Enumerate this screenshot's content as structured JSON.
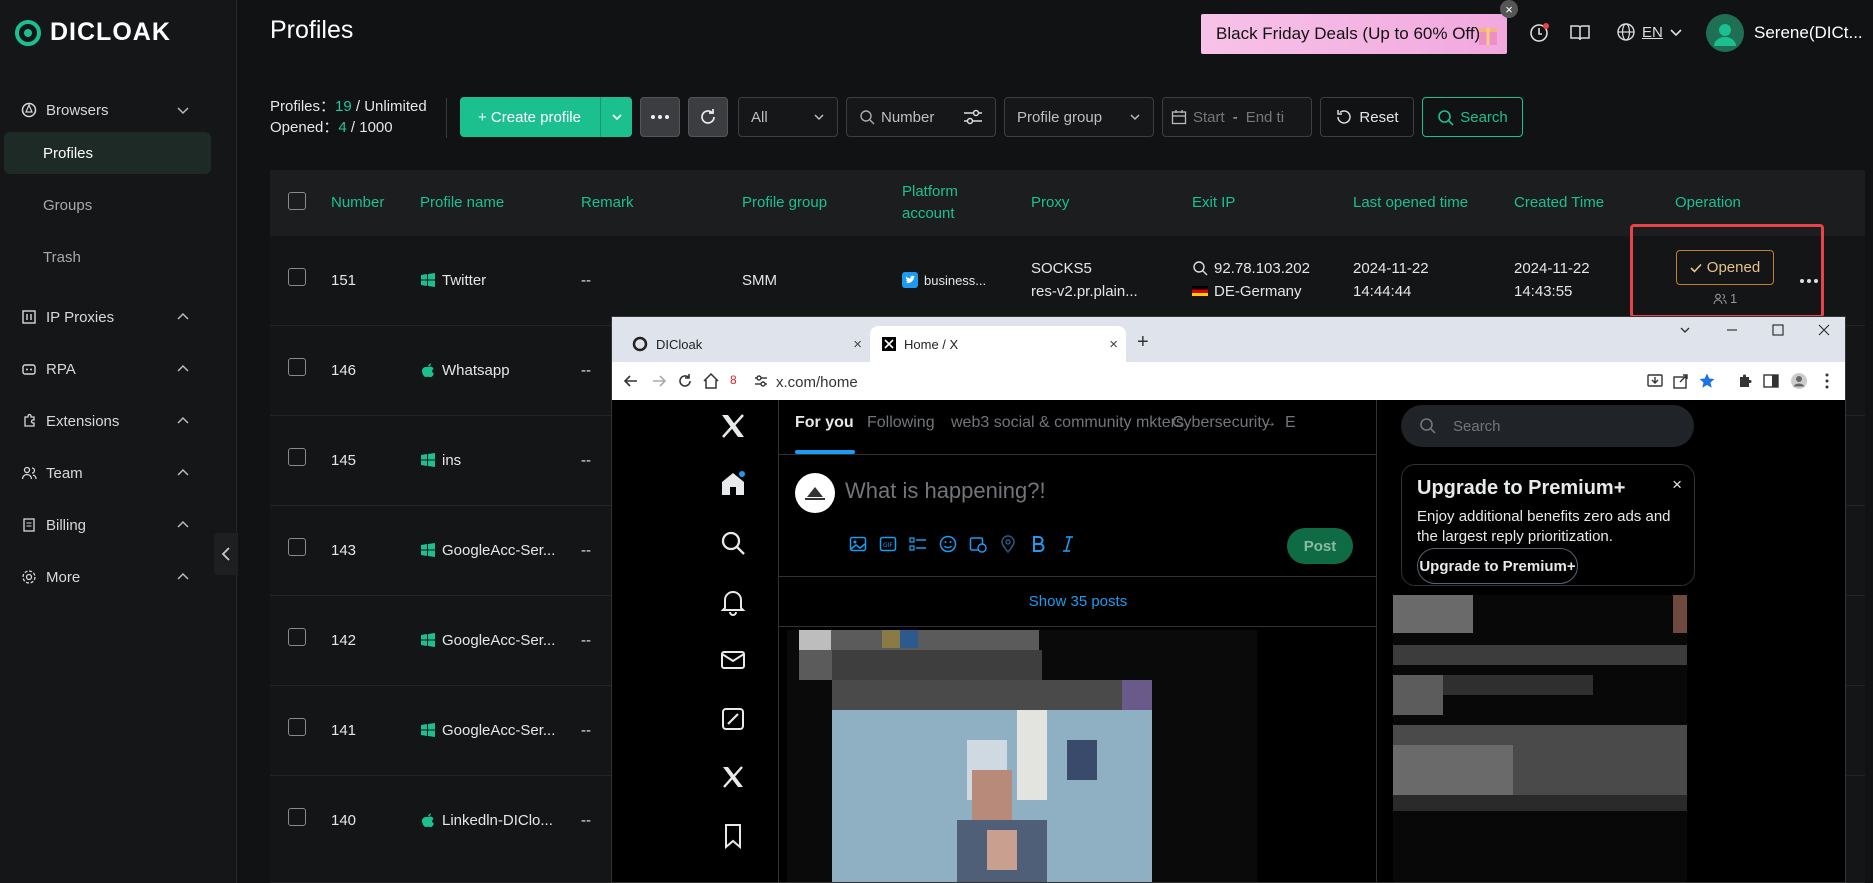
{
  "sidebar": {
    "logo": "DICLOAK",
    "browsers": "Browsers",
    "profiles": "Profiles",
    "groups": "Groups",
    "trash": "Trash",
    "ip_proxies": "IP Proxies",
    "rpa": "RPA",
    "extensions": "Extensions",
    "team": "Team",
    "billing": "Billing",
    "more": "More"
  },
  "header": {
    "title": "Profiles",
    "promo": "Black Friday Deals (Up to 60% Off)",
    "lang": "EN",
    "username": "Serene(DICt..."
  },
  "stats": {
    "profiles_label": "Profiles：",
    "profiles_used": "19",
    "profiles_limit": " / Unlimited",
    "opened_label": "Opened：",
    "opened_used": "4",
    "opened_limit": " / 1000"
  },
  "toolbar": {
    "create_label": "+ Create profile",
    "filter_all": "All",
    "number_placeholder": "Number",
    "profile_group_placeholder": "Profile group",
    "date_start": "Start",
    "date_sep": "-",
    "date_end": "End ti",
    "reset_label": "Reset",
    "search_label": "Search"
  },
  "table": {
    "headers": {
      "number": "Number",
      "name": "Profile name",
      "remark": "Remark",
      "group": "Profile group",
      "platform": "Platform account",
      "proxy": "Proxy",
      "exit_ip": "Exit IP",
      "last_opened": "Last opened time",
      "created": "Created Time",
      "operation": "Operation"
    },
    "rows": [
      {
        "number": "151",
        "name": "Twitter",
        "remark": "--",
        "group": "SMM",
        "platform": "business...",
        "proxy1": "SOCKS5",
        "proxy2": "res-v2.pr.plain...",
        "ip": "92.78.103.202",
        "country": "DE-Germany",
        "last1": "2024-11-22",
        "last2": "14:44:44",
        "created1": "2024-11-22",
        "created2": "14:43:55",
        "op": "Opened",
        "op_count": "1"
      },
      {
        "number": "146",
        "name": "Whatsapp",
        "remark": "--"
      },
      {
        "number": "145",
        "name": "ins",
        "remark": "--"
      },
      {
        "number": "143",
        "name": "GoogleAcc-Ser...",
        "remark": "--"
      },
      {
        "number": "142",
        "name": "GoogleAcc-Ser...",
        "remark": "--"
      },
      {
        "number": "141",
        "name": "GoogleAcc-Ser...",
        "remark": "--"
      },
      {
        "number": "140",
        "name": "Linkedln-DIClo...",
        "remark": "--"
      }
    ]
  },
  "browser": {
    "tab1": "DICloak",
    "tab2": "Home / X",
    "url": "x.com/home",
    "badge": "8"
  },
  "x": {
    "tabs": [
      "For you",
      "Following",
      "web3 social & community mkters",
      "Cybersecurity",
      "→",
      "E"
    ],
    "composer_placeholder": "What is happening?!",
    "post_label": "Post",
    "show_posts": "Show 35 posts",
    "search_placeholder": "Search",
    "premium_title": "Upgrade to Premium+",
    "premium_text": "Enjoy additional benefits zero ads and the largest reply prioritization.",
    "premium_button": "Upgrade to Premium+"
  },
  "colors": {
    "accent": "#1cc08e",
    "x_blue": "#1d9bf0",
    "highlight": "#e8424a"
  }
}
